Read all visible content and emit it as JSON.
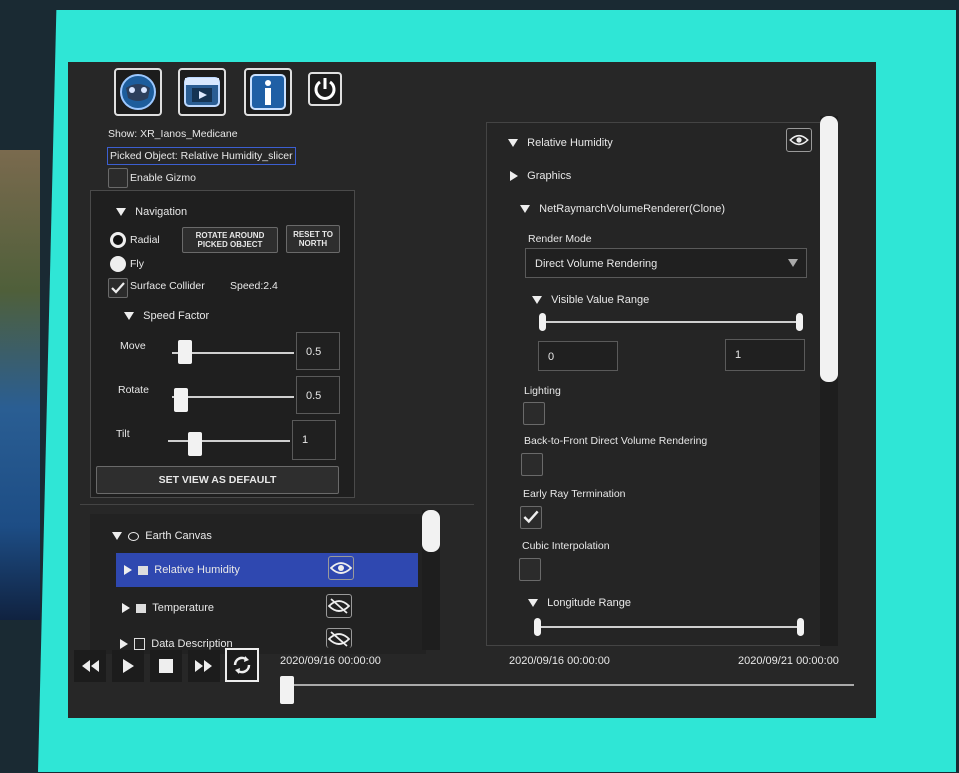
{
  "top_icons": [
    {
      "icon": "earth-layers-icon"
    },
    {
      "icon": "media-player-icon"
    },
    {
      "icon": "info-icon"
    },
    {
      "icon": "power-icon"
    }
  ],
  "left": {
    "show_label": "Show: XR_Ianos_Medicane",
    "picked_object": "Picked Object: Relative Humidity_slicer",
    "enable_gizmo": "Enable Gizmo",
    "navigation": {
      "title": "Navigation",
      "radial": "Radial",
      "fly": "Fly",
      "rotate_button": "ROTATE AROUND PICKED OBJECT",
      "reset_button": "RESET TO NORTH",
      "surface_collider": "Surface Collider",
      "speed": "Speed:2.4",
      "speed_factor": "Speed Factor",
      "move_label": "Move",
      "move_value": "0.5",
      "rotate_label": "Rotate",
      "rotate_value": "0.5",
      "tilt_label": "Tilt",
      "tilt_value": "1",
      "set_default": "SET VIEW AS DEFAULT"
    }
  },
  "tree": {
    "root": "Earth Canvas",
    "items": [
      {
        "label": "Relative Humidity",
        "selected": true,
        "visible": true
      },
      {
        "label": "Temperature",
        "selected": false,
        "visible": false
      },
      {
        "label": "Data Description",
        "selected": false,
        "visible": false
      }
    ]
  },
  "inspector": {
    "title": "Relative Humidity",
    "graphics": "Graphics",
    "component": "NetRaymarchVolumeRenderer(Clone)",
    "render_mode_label": "Render Mode",
    "render_mode_value": "Direct Volume Rendering",
    "visible_value_range": "Visible Value Range",
    "range_min": "0",
    "range_max": "1",
    "lighting": "Lighting",
    "back_to_front": "Back-to-Front Direct Volume Rendering",
    "early_ray": "Early Ray Termination",
    "cubic": "Cubic Interpolation",
    "longitude_range": "Longitude Range",
    "lighting_checked": false,
    "back_to_front_checked": false,
    "early_ray_checked": true,
    "cubic_checked": false
  },
  "timeline": {
    "current": "2020/09/16 00:00:00",
    "start": "2020/09/16 00:00:00",
    "end": "2020/09/21 00:00:00",
    "progress": 0
  },
  "colors": {
    "frame": "#2fe6d6",
    "panel": "#272727",
    "selection": "#2f48b0"
  }
}
